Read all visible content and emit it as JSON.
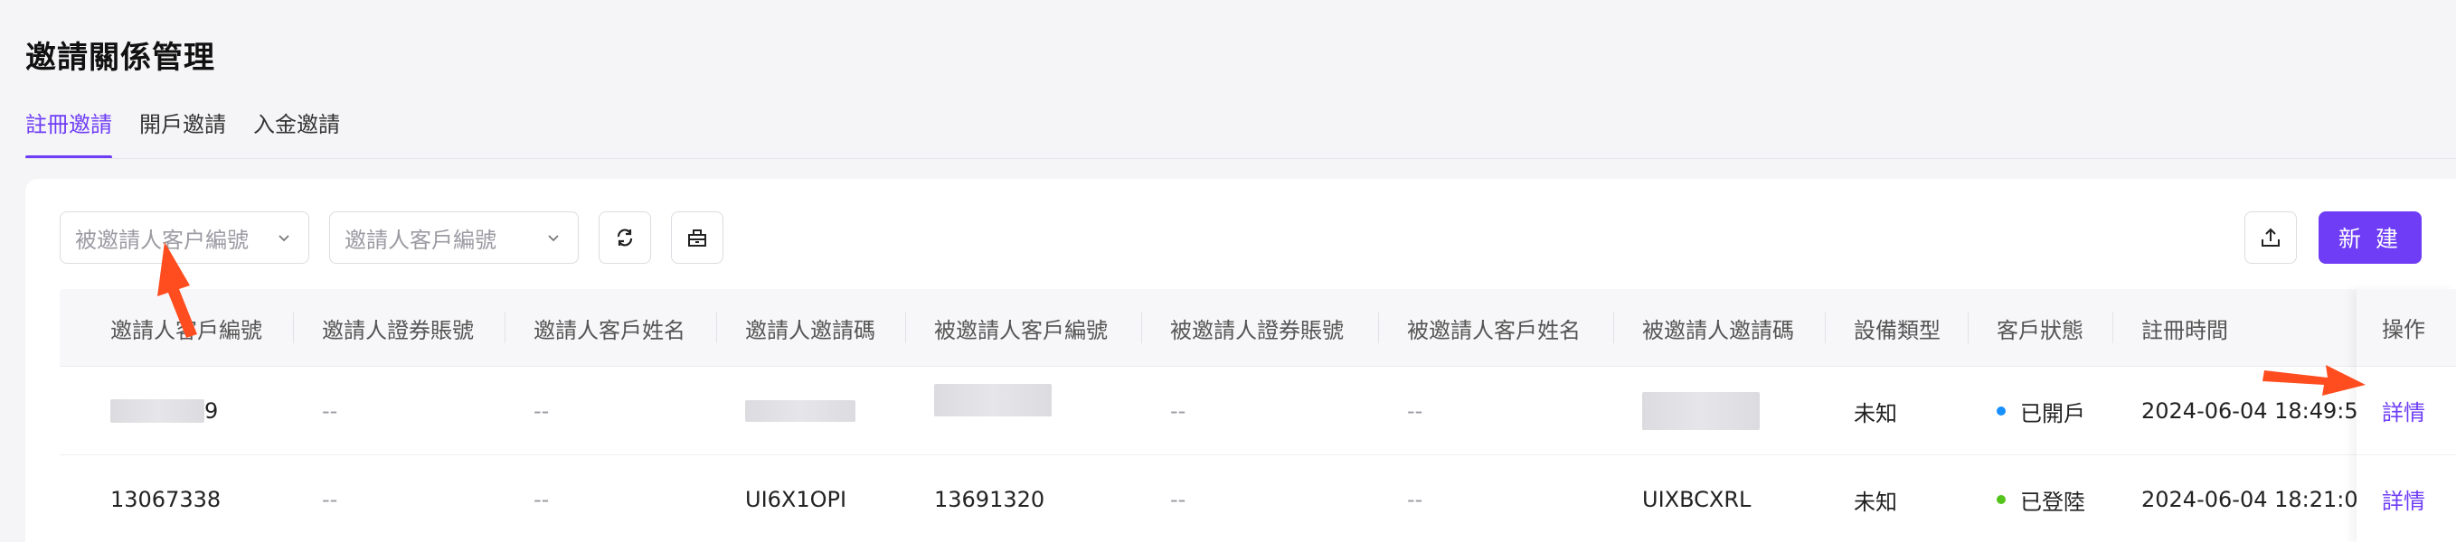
{
  "page": {
    "title": "邀請關係管理"
  },
  "tabs": [
    {
      "label": "註冊邀請",
      "active": true
    },
    {
      "label": "開戶邀請",
      "active": false
    },
    {
      "label": "入金邀請",
      "active": false
    }
  ],
  "toolbar": {
    "invitee_select_placeholder": "被邀請人客户編號",
    "inviter_select_placeholder": "邀請人客戶編號",
    "refresh_icon": "refresh-icon",
    "clear_icon": "clear-icon",
    "export_icon": "export-icon",
    "new_button_label": "新 建"
  },
  "table": {
    "columns": [
      "邀請人客戶編號",
      "邀請人證券賬號",
      "邀請人客戶姓名",
      "邀請人邀請碼",
      "被邀請人客戶編號",
      "被邀請人證券賬號",
      "被邀請人客戶姓名",
      "被邀請人邀請碼",
      "設備類型",
      "客戶狀態",
      "註冊時間",
      "操作"
    ],
    "rows": [
      {
        "inviter_id": "9",
        "inviter_account": "--",
        "inviter_name": "--",
        "inviter_code": "",
        "invitee_id": "",
        "invitee_account": "--",
        "invitee_name": "--",
        "invitee_code": "",
        "device": "未知",
        "status": "已開戶",
        "status_color": "#1890ff",
        "reg_time": "2024-06-04 18:49:5",
        "action": "詳情"
      },
      {
        "inviter_id": "13067338",
        "inviter_account": "--",
        "inviter_name": "--",
        "inviter_code": "UI6X1OPI",
        "invitee_id": "13691320",
        "invitee_account": "--",
        "invitee_name": "--",
        "invitee_code": "UIXBCXRL",
        "device": "未知",
        "status": "已登陸",
        "status_color": "#52c41a",
        "reg_time": "2024-06-04 18:21:0",
        "action": "詳情"
      }
    ]
  },
  "colors": {
    "accent": "#6e3df5",
    "annotation_arrow": "#ff4d1f"
  }
}
